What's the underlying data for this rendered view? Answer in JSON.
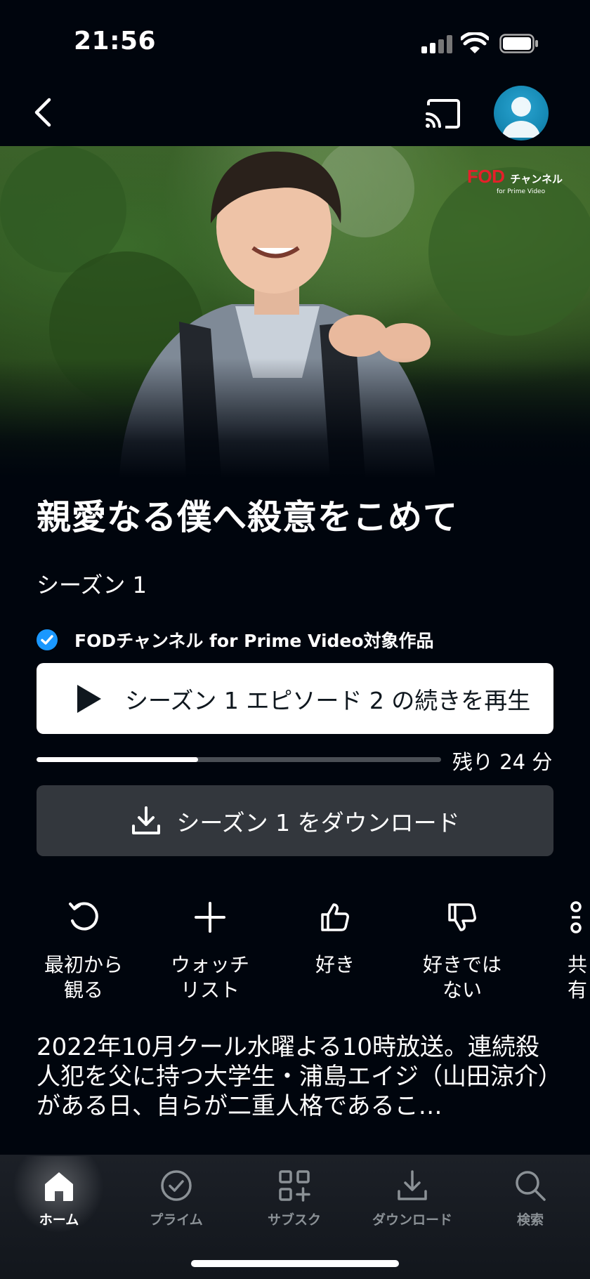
{
  "status_bar": {
    "time": "21:56"
  },
  "hero": {
    "channel_logo_main": "FOD",
    "channel_logo_ch": "チャンネル",
    "channel_logo_sub": "for Prime Video"
  },
  "title": "親愛なる僕へ殺意をこめて",
  "season": "シーズン 1",
  "channel_badge": "FODチャンネル for Prime Video対象作品",
  "play_button": {
    "label": "シーズン 1 エピソード 2 の続きを再生"
  },
  "progress": {
    "fraction": 0.4,
    "remaining": "残り 24 分"
  },
  "download_button": {
    "label": "シーズン 1 をダウンロード"
  },
  "actions": [
    {
      "line1": "最初から",
      "line2": "観る",
      "icon": "restart-icon"
    },
    {
      "line1": "ウォッチ",
      "line2": "リスト",
      "icon": "plus-icon"
    },
    {
      "line1": "好き",
      "line2": "",
      "icon": "thumbs-up-icon"
    },
    {
      "line1": "好きでは",
      "line2": "ない",
      "icon": "thumbs-down-icon"
    },
    {
      "line1": "共有",
      "line2": "",
      "icon": "share-icon"
    }
  ],
  "description": "2022年10月クール水曜よる10時放送。連続殺人犯を父に持つ大学生・浦島エイジ（山田涼介）がある日、自らが二重人格であるこ…",
  "tabs": [
    {
      "label": "ホーム",
      "icon": "home-icon",
      "active": true
    },
    {
      "label": "プライム",
      "icon": "check-circle-icon",
      "active": false
    },
    {
      "label": "サブスク",
      "icon": "grid-plus-icon",
      "active": false
    },
    {
      "label": "ダウンロード",
      "icon": "download-icon",
      "active": false
    },
    {
      "label": "検索",
      "icon": "search-icon",
      "active": false
    }
  ],
  "colors": {
    "background": "#00050d",
    "accent_blue": "#1a98ff",
    "fod_red": "#e5202a",
    "secondary_button": "#33373d"
  }
}
